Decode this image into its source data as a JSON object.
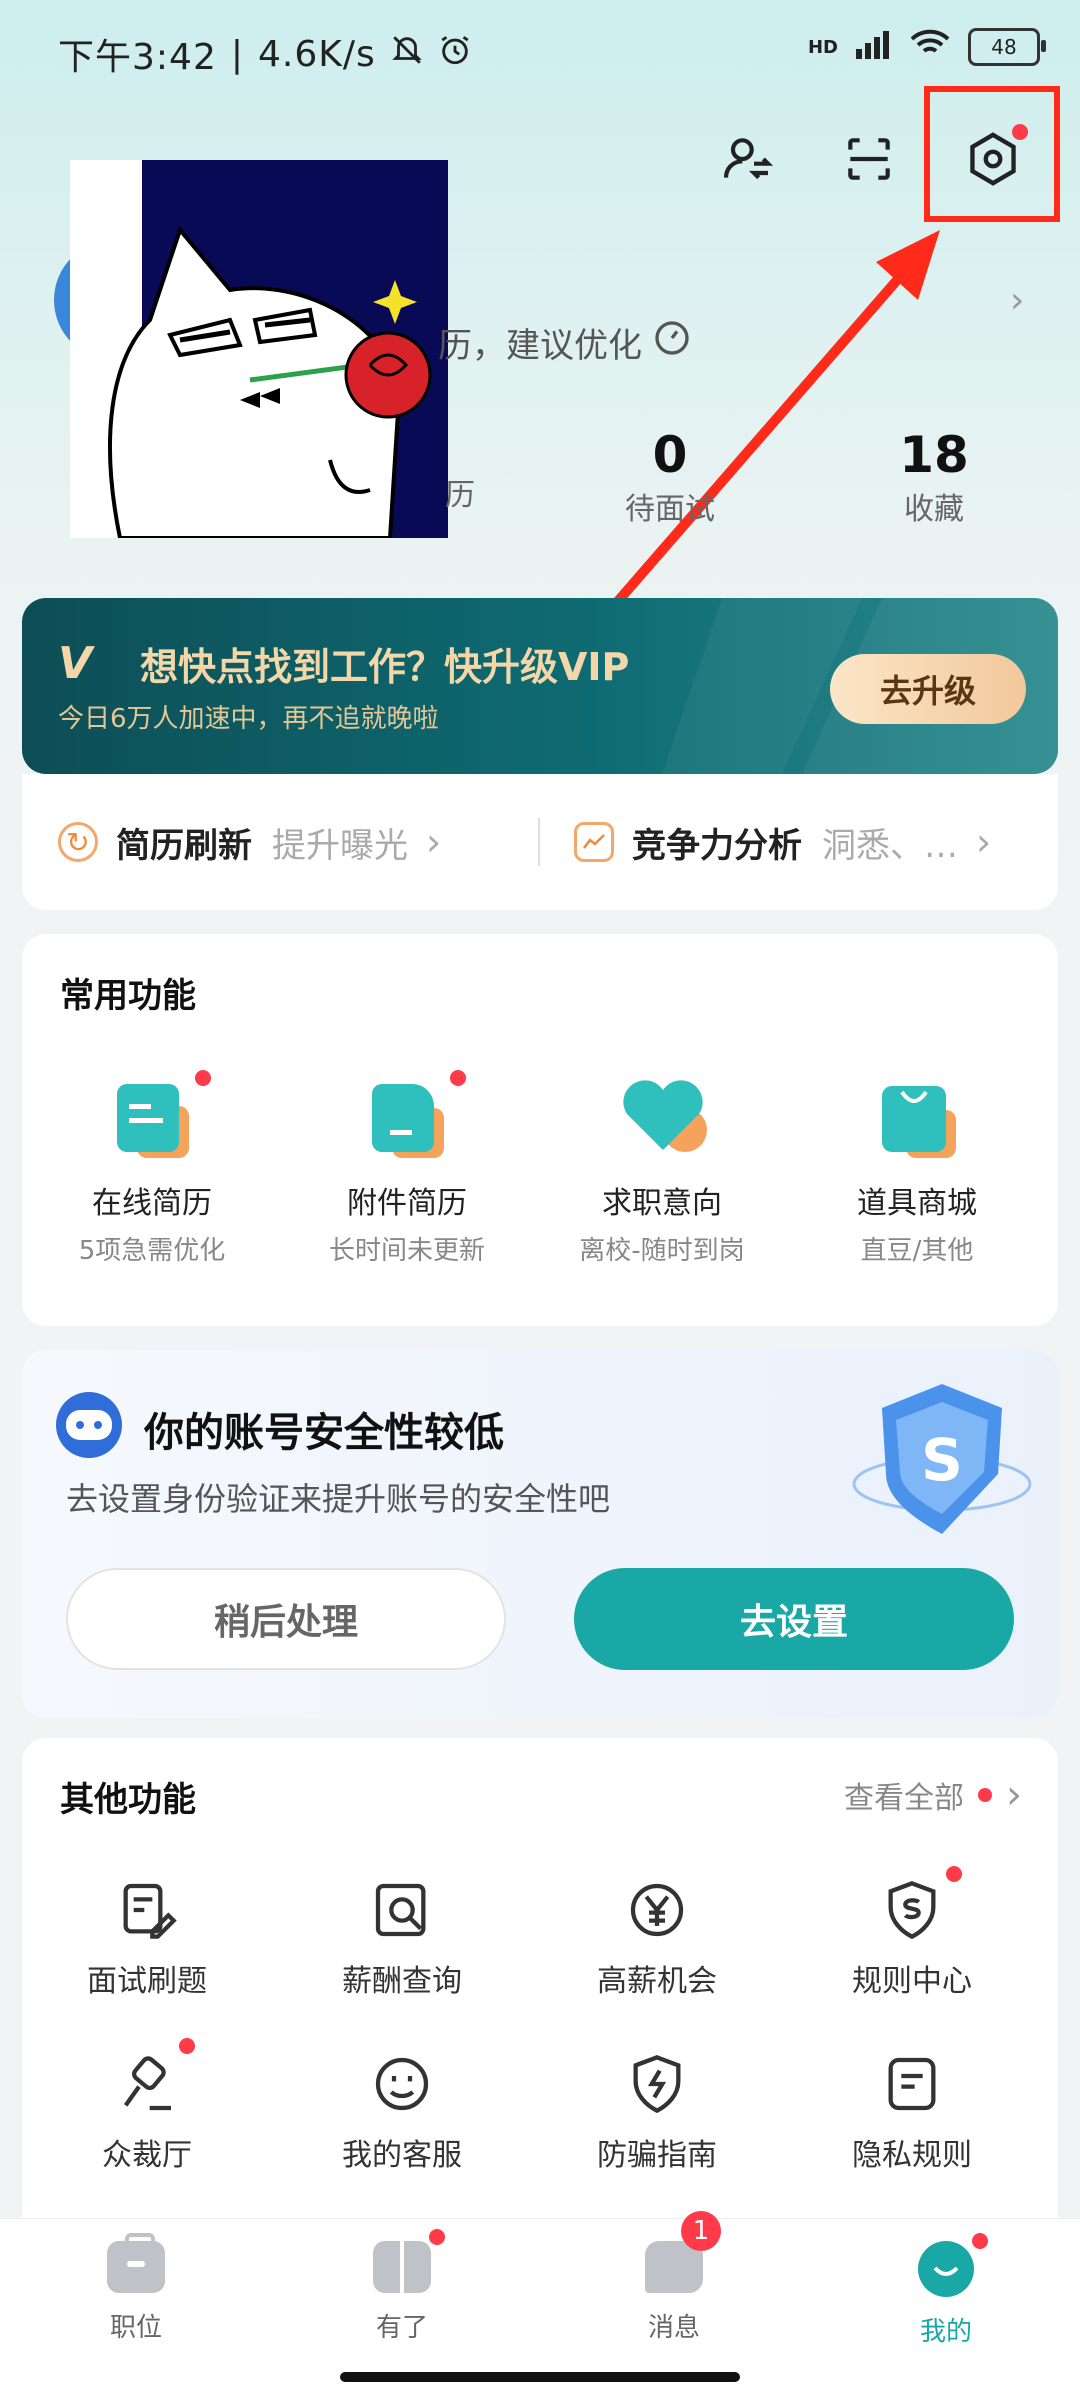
{
  "status_bar": {
    "time": "下午3:42",
    "speed": "4.6K/s",
    "network": "HD",
    "battery": "48"
  },
  "profile": {
    "tip_text": "历，建议优化",
    "stats": [
      {
        "value": "",
        "label": "历"
      },
      {
        "value": "0",
        "label": "待面试"
      },
      {
        "value": "18",
        "label": "收藏"
      }
    ]
  },
  "vip_banner": {
    "logo": "V",
    "title": "想快点找到工作？快升级VIP",
    "subtitle": "今日6万人加速中，再不追就晚啦",
    "button": "去升级"
  },
  "quick_row": [
    {
      "title": "简历刷新",
      "desc": "提升曝光",
      "icon": "refresh-icon"
    },
    {
      "title": "竞争力分析",
      "desc": "洞悉、…",
      "icon": "chart-icon"
    }
  ],
  "common_functions": {
    "title": "常用功能",
    "items": [
      {
        "name": "在线简历",
        "sub": "5项急需优化",
        "color": "#2fbfbd",
        "accent": "#f5a35a"
      },
      {
        "name": "附件简历",
        "sub": "长时间未更新",
        "color": "#2fbfbd",
        "accent": "#f5a35a"
      },
      {
        "name": "求职意向",
        "sub": "离校-随时到岗",
        "color": "#2fbfbd",
        "accent": "#f5a35a"
      },
      {
        "name": "道具商城",
        "sub": "直豆/其他",
        "color": "#2fbfbd",
        "accent": "#f5a35a"
      }
    ]
  },
  "security_card": {
    "title": "你的账号安全性较低",
    "desc": "去设置身份验证来提升账号的安全性吧",
    "later_button": "稍后处理",
    "set_button": "去设置"
  },
  "other_functions": {
    "title": "其他功能",
    "view_all": "查看全部",
    "items": [
      {
        "name": "面试刷题",
        "icon": "edit-doc-icon"
      },
      {
        "name": "薪酬查询",
        "icon": "search-doc-icon"
      },
      {
        "name": "高薪机会",
        "icon": "yuan-icon"
      },
      {
        "name": "规则中心",
        "icon": "shield-s-icon"
      },
      {
        "name": "众裁厅",
        "icon": "gavel-icon"
      },
      {
        "name": "我的客服",
        "icon": "smile-icon"
      },
      {
        "name": "防骗指南",
        "icon": "shield-bolt-icon"
      },
      {
        "name": "隐私规则",
        "icon": "doc-lines-icon"
      }
    ]
  },
  "bottom_nav": [
    {
      "label": "职位",
      "icon": "briefcase-icon"
    },
    {
      "label": "有了",
      "icon": "book-icon"
    },
    {
      "label": "消息",
      "icon": "chat-icon",
      "badge": "1"
    },
    {
      "label": "我的",
      "icon": "me-icon",
      "active": true
    }
  ],
  "colors": {
    "accent": "#19a8a6",
    "badge_red": "#ff3b4a",
    "annotation_red": "#ff2a1a"
  }
}
